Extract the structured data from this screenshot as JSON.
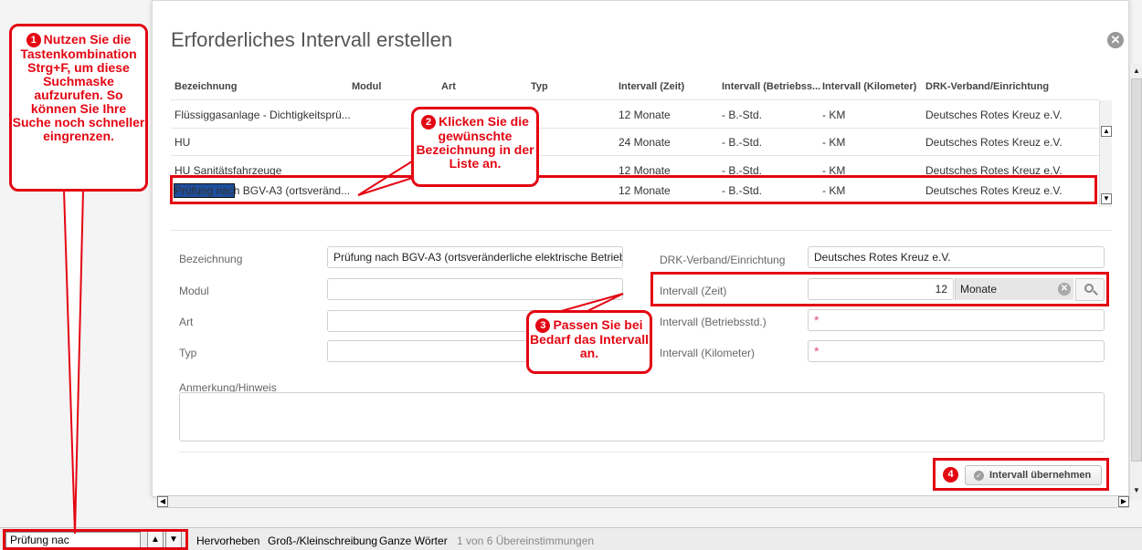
{
  "dialog": {
    "title": "Erforderliches Intervall erstellen",
    "close_glyph": "✕"
  },
  "grid": {
    "columns": [
      "Bezeichnung",
      "Modul",
      "Art",
      "Typ",
      "Intervall (Zeit)",
      "Intervall (Betriebss...",
      "Intervall (Kilometer)",
      "DRK-Verband/Einrichtung"
    ],
    "rows": [
      {
        "bezeichnung": "Flüssiggasanlage - Dichtigkeitsprü...",
        "zeit": "12 Monate",
        "betrieb": "- B.-Std.",
        "km": "- KM",
        "verband": "Deutsches Rotes Kreuz e.V."
      },
      {
        "bezeichnung": "HU",
        "zeit": "24 Monate",
        "betrieb": "- B.-Std.",
        "km": "- KM",
        "verband": "Deutsches Rotes Kreuz e.V."
      },
      {
        "bezeichnung": "HU Sanitätsfahrzeuge",
        "zeit": "12 Monate",
        "betrieb": "- B.-Std.",
        "km": "- KM",
        "verband": "Deutsches Rotes Kreuz e.V."
      },
      {
        "bezeichnung_highlight": "Prüfung nac",
        "bezeichnung_rest": "h BGV-A3 (ortsveränd...",
        "zeit": "12 Monate",
        "betrieb": "- B.-Std.",
        "km": "- KM",
        "verband": "Deutsches Rotes Kreuz e.V."
      }
    ]
  },
  "form": {
    "bezeichnung_label": "Bezeichnung",
    "bezeichnung_value": "Prüfung nach BGV-A3 (ortsveränderliche elektrische Betriebsm",
    "modul_label": "Modul",
    "art_label": "Art",
    "typ_label": "Typ",
    "verband_label": "DRK-Verband/Einrichtung",
    "verband_value": "Deutsches Rotes Kreuz e.V.",
    "zeit_label": "Intervall (Zeit)",
    "zeit_value": "12",
    "zeit_unit": "Monate",
    "betrieb_label": "Intervall (Betriebsstd.)",
    "km_label": "Intervall (Kilometer)",
    "required_mark": "*",
    "anmerkung_label": "Anmerkung/Hinweis",
    "apply_label": "Intervall übernehmen"
  },
  "findbar": {
    "query": "Prüfung nac",
    "hervorheben": "Hervorheben",
    "gross_klein": "Groß-/Kleinschreibung",
    "ganze_woerter": "Ganze Wörter",
    "matches": "1 von 6 Übereinstimmungen"
  },
  "annotations": {
    "step1_num": "1",
    "step1_text": "Nutzen Sie die Tastenkombination Strg+F, um diese Suchmaske aufzurufen. So können Sie Ihre Suche noch schneller eingrenzen.",
    "step2_num": "2",
    "step2_text": "Klicken Sie die gewünschte Bezeichnung in der Liste an.",
    "step3_num": "3",
    "step3_text": "Passen Sie bei Bedarf das Intervall an.",
    "step4_num": "4"
  },
  "colors": {
    "annotation_red": "#e30613",
    "selection_blue": "#1f4e9c",
    "required_pink": "#e0507a"
  }
}
